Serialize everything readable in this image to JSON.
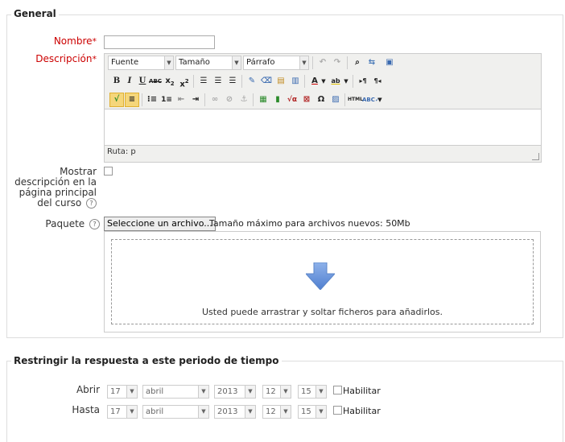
{
  "general": {
    "legend": "General",
    "name_label": "Nombre",
    "required_mark": "*",
    "description_label": "Descripción",
    "editor": {
      "font_label": "Fuente",
      "size_label": "Tamaño",
      "format_label": "Párrafo",
      "path_label": "Ruta: p"
    },
    "show_description_label": "Mostrar descripción en la página principal del curso",
    "help_glyph": "?",
    "package_label": "Paquete",
    "file_button_label": "Seleccione un archivo...",
    "max_size_text": "Tamaño máximo para archivos nuevos: 50Mb",
    "drop_text": "Usted puede arrastrar y soltar ficheros para añadirlos."
  },
  "restrict": {
    "legend": "Restringir la respuesta a este periodo de tiempo",
    "open": {
      "label": "Abrir",
      "day": "17",
      "month": "abril",
      "year": "2013",
      "hour": "12",
      "minute": "15",
      "enable_label": "Habilitar"
    },
    "until": {
      "label": "Hasta",
      "day": "17",
      "month": "abril",
      "year": "2013",
      "hour": "12",
      "minute": "15",
      "enable_label": "Habilitar"
    }
  },
  "colors": {
    "required": "#cc0000",
    "arrow": "#5b8bd6",
    "highlight": "#f5d67a"
  }
}
